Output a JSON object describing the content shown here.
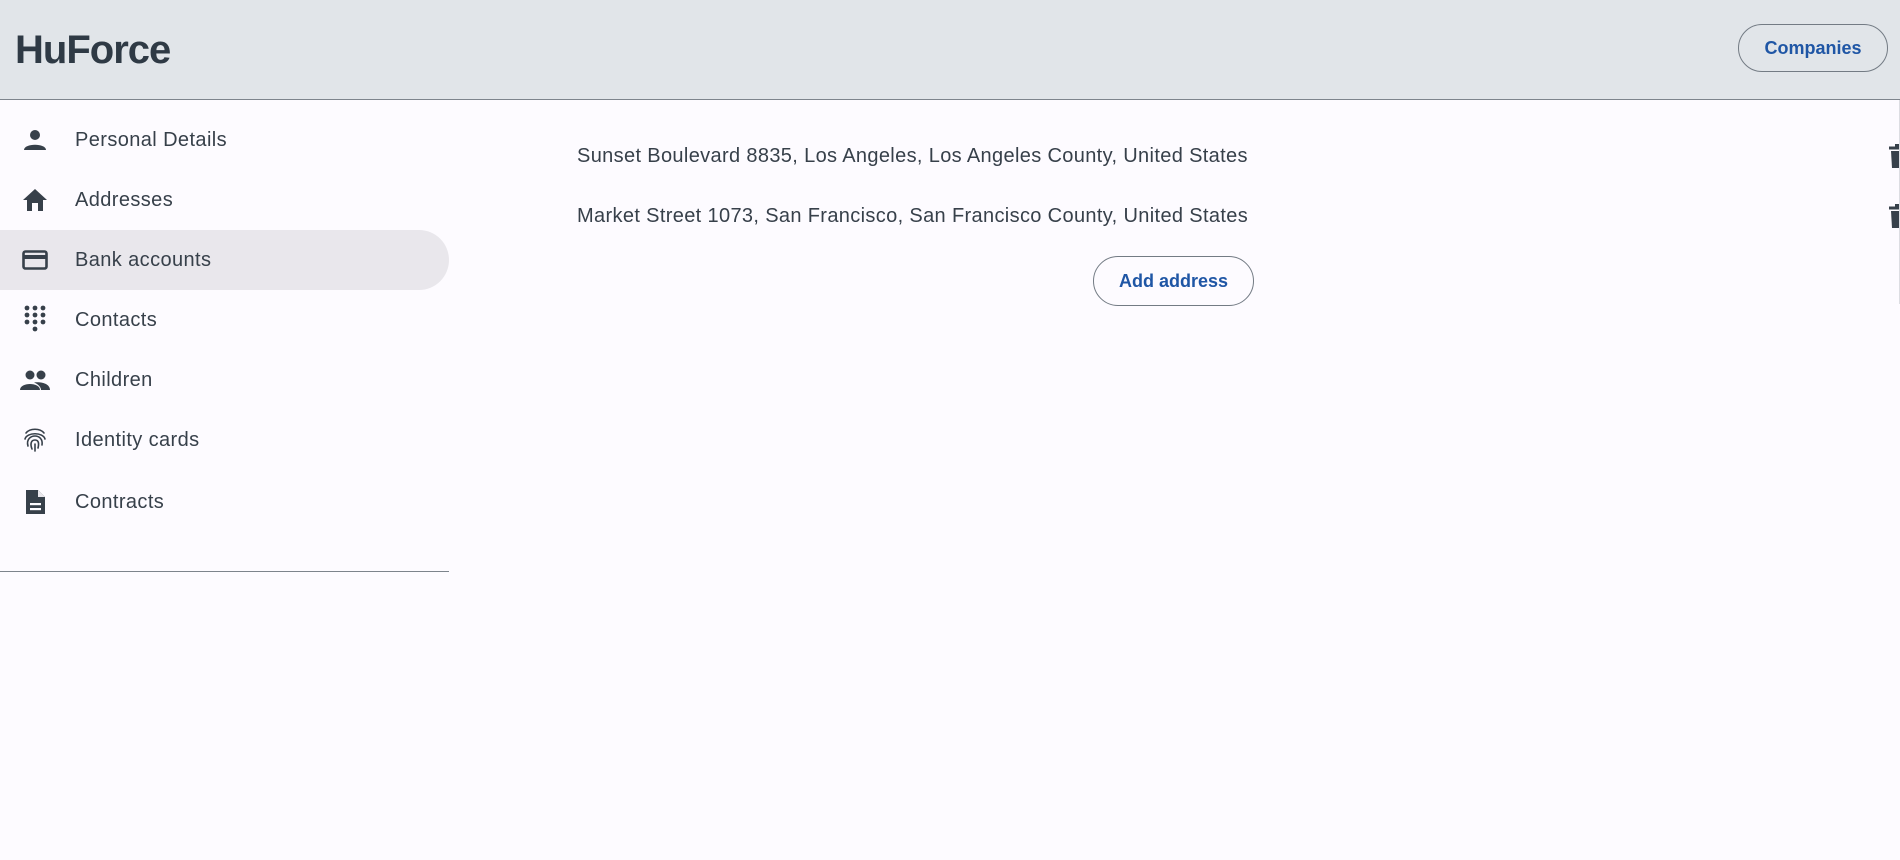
{
  "header": {
    "logo": "HuForce",
    "companies_button": "Companies"
  },
  "sidebar": {
    "items": [
      {
        "label": "Personal Details",
        "icon": "person-icon"
      },
      {
        "label": "Addresses",
        "icon": "home-icon"
      },
      {
        "label": "Bank accounts",
        "icon": "credit-card-icon",
        "active": true
      },
      {
        "label": "Contacts",
        "icon": "dialpad-icon"
      },
      {
        "label": "Children",
        "icon": "people-icon"
      },
      {
        "label": "Identity cards",
        "icon": "fingerprint-icon"
      },
      {
        "label": "Contracts",
        "icon": "document-icon"
      }
    ]
  },
  "main": {
    "addresses": [
      {
        "text": "Sunset Boulevard 8835, Los Angeles, Los Angeles County, United States"
      },
      {
        "text": "Market Street 1073, San Francisco, San Francisco County, United States"
      }
    ],
    "add_button": "Add address"
  },
  "colors": {
    "header_bg": "#e1e5e9",
    "page_bg": "#fdfbff",
    "accent": "#1f56a5",
    "text": "#37404a",
    "active_bg": "#e9e7ec"
  }
}
